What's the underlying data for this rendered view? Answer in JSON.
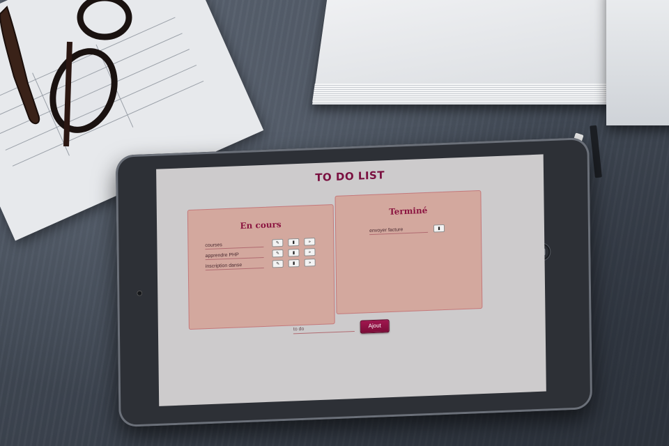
{
  "app": {
    "title": "TO DO LIST"
  },
  "in_progress": {
    "title": "En cours",
    "tasks": [
      {
        "label": "courses"
      },
      {
        "label": "apprendre PHP"
      },
      {
        "label": "inscription danse"
      }
    ]
  },
  "done": {
    "title": "Terminé",
    "tasks": [
      {
        "label": "envoyer facture"
      }
    ]
  },
  "icons": {
    "edit": "edit-icon",
    "delete": "trash-icon",
    "move": "double-chevron-right-icon"
  },
  "glyphs": {
    "edit": "✎",
    "delete": "▮",
    "move": "»"
  },
  "new_task": {
    "placeholder": "to do",
    "value": ""
  },
  "add_button": {
    "label": "Ajout"
  },
  "colors": {
    "accent": "#7a1040",
    "panel": "#d3a89e",
    "button": "#8f1244",
    "screen": "#cdcbcc"
  }
}
